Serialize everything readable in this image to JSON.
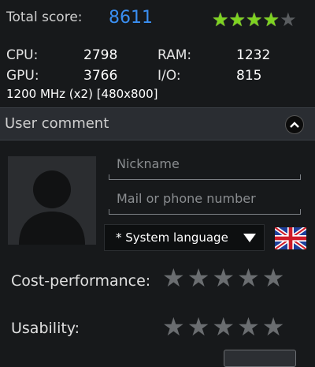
{
  "score": {
    "label": "Total score:",
    "value": "8611",
    "stars_filled": 4,
    "stars_total": 5
  },
  "stats": {
    "cpu_label": "CPU:",
    "cpu_value": "2798",
    "ram_label": "RAM:",
    "ram_value": "1232",
    "gpu_label": "GPU:",
    "gpu_value": "3766",
    "io_label": "I/O:",
    "io_value": "815"
  },
  "device_info": "1200 MHz (x2) [480x800]",
  "comment": {
    "title": "User comment",
    "nickname_placeholder": "Nickname",
    "contact_placeholder": "Mail or phone number",
    "language": "* System language",
    "flag_icon": "uk-flag-icon"
  },
  "ratings": [
    {
      "label": "Cost-performance:",
      "value": 0,
      "max": 5
    },
    {
      "label": "Usability:",
      "value": 0,
      "max": 5
    }
  ],
  "colors": {
    "score_accent": "#3a8ff2",
    "star_filled": "#7ed321",
    "star_empty": "#5a5d60"
  }
}
